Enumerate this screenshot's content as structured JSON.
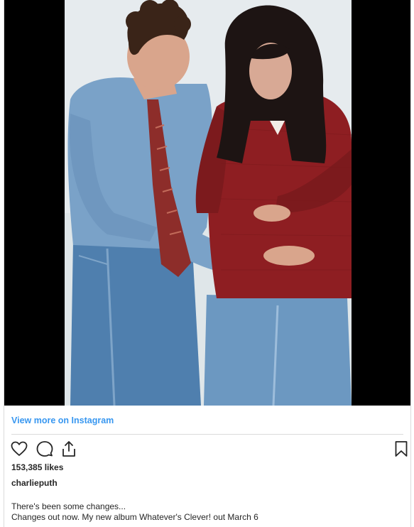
{
  "post": {
    "view_more_label": "View more on Instagram",
    "likes_text": "153,385 likes",
    "username": "charlieputh",
    "caption_lines": [
      "There's been some changes...",
      "Changes out now. My new album Whatever's Clever! out March 6"
    ]
  },
  "icons": {
    "like": "heart-icon",
    "comment": "comment-icon",
    "share": "share-icon",
    "save": "bookmark-icon"
  },
  "colors": {
    "link": "#3897f0",
    "text": "#262626",
    "divider": "#dbdbdb",
    "media_background": "#000000"
  }
}
